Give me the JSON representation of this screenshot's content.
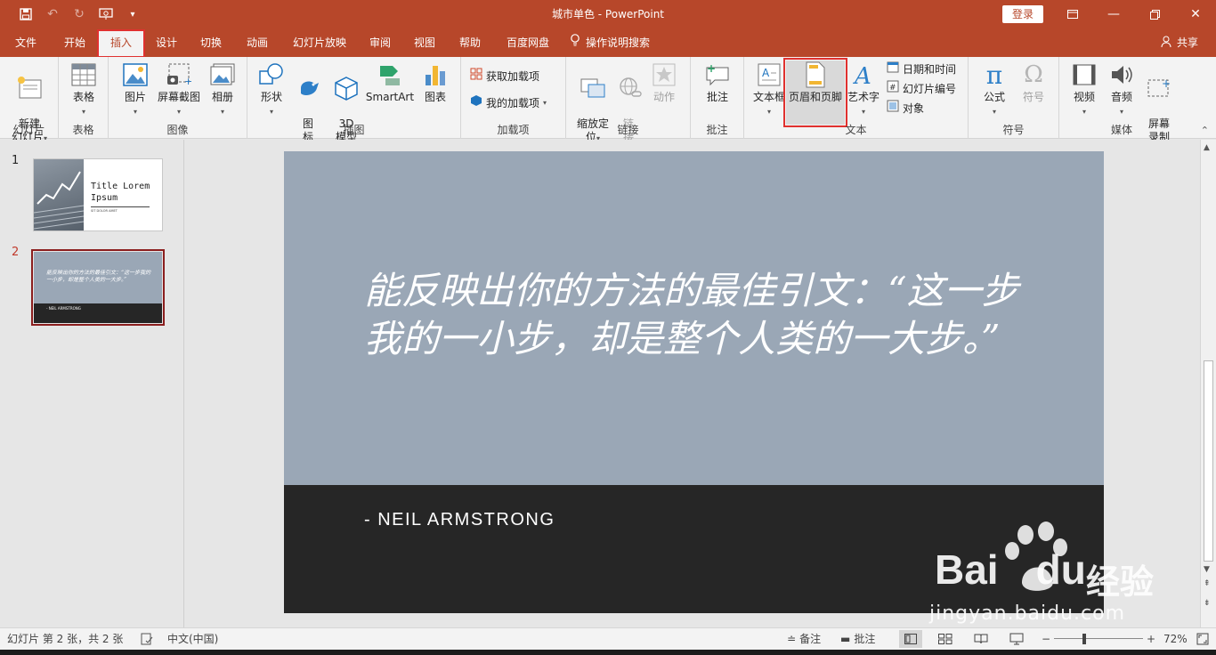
{
  "window": {
    "title": "城市单色  -  PowerPoint",
    "login_label": "登录",
    "share_label": "共享"
  },
  "qat": {
    "save_icon": "save-icon",
    "undo_icon": "undo-icon",
    "redo_icon": "redo-icon",
    "present_icon": "from-beginning-icon",
    "customize_icon": "customize-icon"
  },
  "tabs": [
    {
      "label": "文件"
    },
    {
      "label": "开始"
    },
    {
      "label": "插入"
    },
    {
      "label": "设计"
    },
    {
      "label": "切换"
    },
    {
      "label": "动画"
    },
    {
      "label": "幻灯片放映"
    },
    {
      "label": "审阅"
    },
    {
      "label": "视图"
    },
    {
      "label": "帮助"
    },
    {
      "label": "百度网盘"
    },
    {
      "label": "操作说明搜索"
    }
  ],
  "ribbon": {
    "groups": {
      "slides": "幻灯片",
      "tables": "表格",
      "images": "图像",
      "illustrations": "插图",
      "addins": "加载项",
      "links": "链接",
      "comments": "批注",
      "text": "文本",
      "symbols": "符号",
      "media": "媒体"
    },
    "new_slide": "新建\n幻灯片",
    "table": "表格",
    "picture": "图片",
    "screenshot": "屏幕截图",
    "album": "相册",
    "shapes": "形状",
    "icons": "图\n标",
    "model3d": "3D\n模型",
    "smartart": "SmartArt",
    "chart": "图表",
    "get_addins": "获取加载项",
    "my_addins": "我的加载项",
    "zoom": "缩放定\n位",
    "link": "链\n接",
    "action": "动作",
    "comment": "批注",
    "textbox": "文本框",
    "header_footer": "页眉和页脚",
    "wordart": "艺术字",
    "datetime": "日期和时间",
    "slide_number": "幻灯片编号",
    "object": "对象",
    "equation": "公式",
    "symbol": "符号",
    "video": "视频",
    "audio": "音频",
    "screen_record": "屏幕\n录制"
  },
  "thumbnails": [
    {
      "number": "1",
      "title": "Title Lorem\nIpsum",
      "subtitle": "SIT DOLOR AMET"
    },
    {
      "number": "2",
      "quote": "能反映出你的方法的最佳引文：“这一步我的一小步，却是整个人类的一大步。”",
      "author": "- NEIL ARMSTRONG"
    }
  ],
  "slide": {
    "quote": "能反映出你的方法的最佳引文：“这一步我的一小步，却是整个人类的一大步。”",
    "author": "- NEIL ARMSTRONG"
  },
  "watermark": {
    "brand": "Bai",
    "brand2": "du",
    "cn": "经验",
    "url": "jingyan.baidu.com"
  },
  "status": {
    "slide_info": "幻灯片 第 2 张，共 2 张",
    "language": "中文(中国)",
    "notes": "备注",
    "comments": "批注",
    "zoom": "72%"
  },
  "colors": {
    "accent": "#b7472a",
    "highlight": "#e0312f",
    "slide_top": "#9aa7b6",
    "slide_bottom": "#262626"
  }
}
